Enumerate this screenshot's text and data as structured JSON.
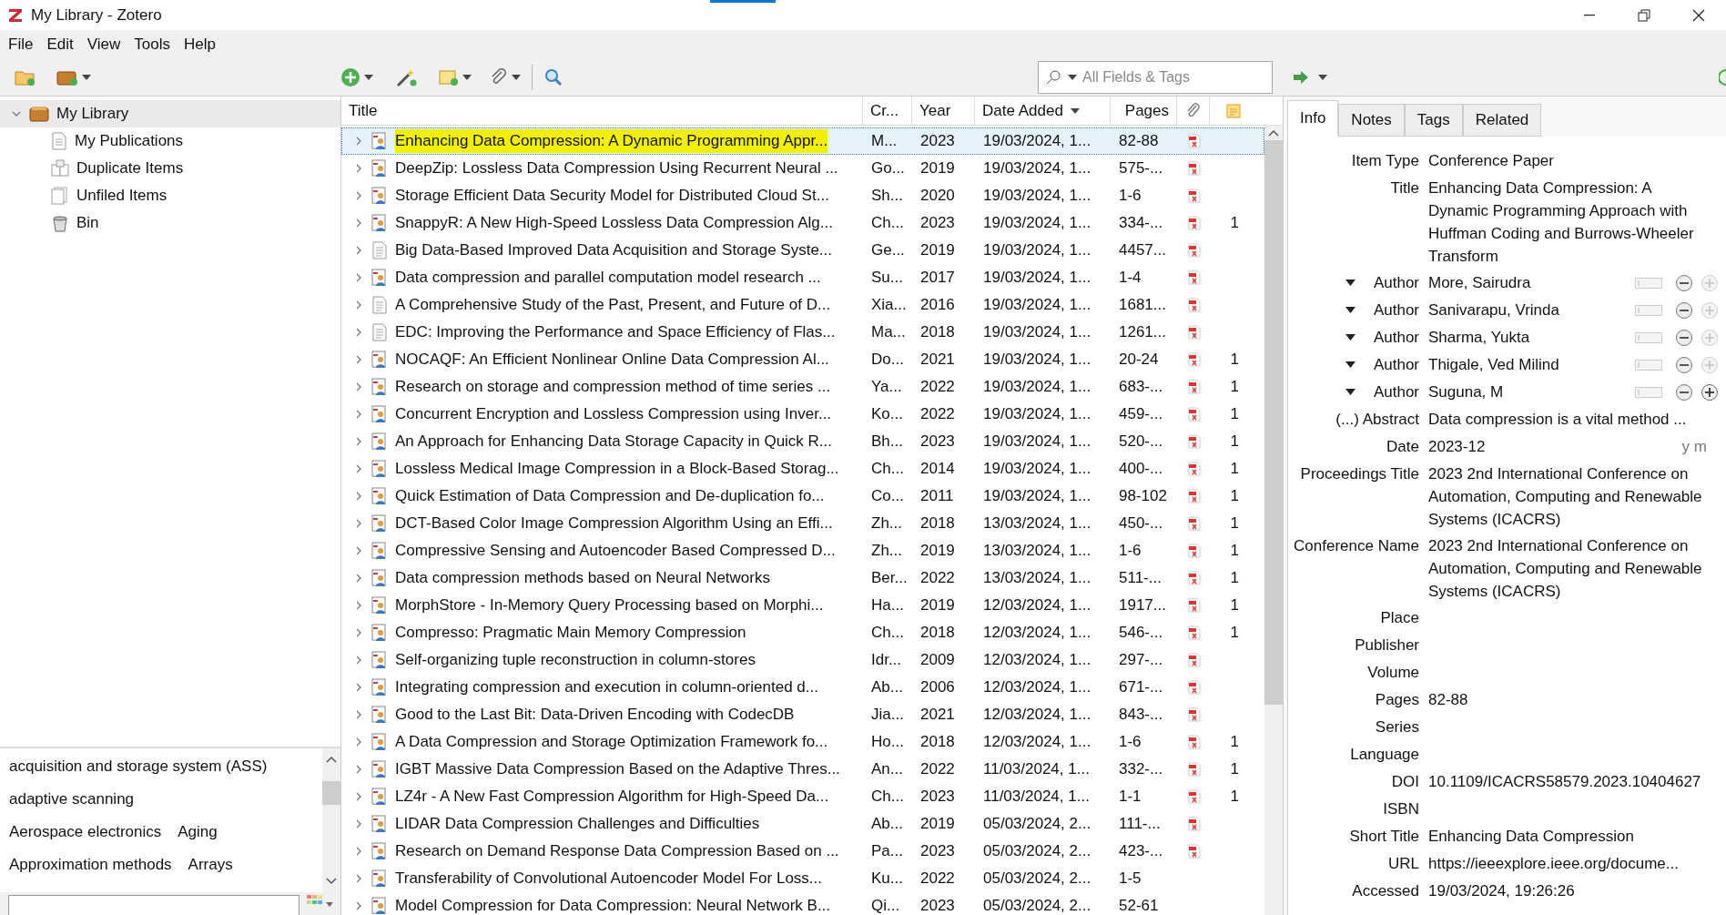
{
  "window": {
    "title": "My Library - Zotero"
  },
  "menu": [
    "File",
    "Edit",
    "View",
    "Tools",
    "Help"
  ],
  "search": {
    "placeholder": "All Fields & Tags"
  },
  "collections": [
    {
      "label": "My Library",
      "kind": "library",
      "expanded": true,
      "children": [
        {
          "label": "My Publications",
          "kind": "publications"
        },
        {
          "label": "Duplicate Items",
          "kind": "duplicates"
        },
        {
          "label": "Unfiled Items",
          "kind": "unfiled"
        },
        {
          "label": "Bin",
          "kind": "bin"
        }
      ]
    }
  ],
  "tags": [
    [
      "acquisition and storage system (ASS)"
    ],
    [
      "adaptive scanning"
    ],
    [
      "Aerospace electronics",
      "Aging"
    ],
    [
      "Approximation methods",
      "Arrays"
    ]
  ],
  "table": {
    "columns": [
      "Title",
      "Cr...",
      "Year",
      "Date Added",
      "Pages"
    ],
    "rows": [
      {
        "title": "Enhancing Data Compression: A Dynamic Programming Appr...",
        "creator": "M...",
        "year": "2023",
        "date": "19/03/2024, 1...",
        "pages": "82-88",
        "kind": "paper",
        "pdf": true,
        "notes": "",
        "selected": true,
        "highlighted": true
      },
      {
        "title": "DeepZip: Lossless Data Compression Using Recurrent Neural ...",
        "creator": "Go...",
        "year": "2019",
        "date": "19/03/2024, 1...",
        "pages": "575-...",
        "kind": "paper",
        "pdf": true,
        "notes": "",
        "selected": false,
        "highlighted": false
      },
      {
        "title": "Storage Efficient Data Security Model for Distributed Cloud St...",
        "creator": "Sh...",
        "year": "2020",
        "date": "19/03/2024, 1...",
        "pages": "1-6",
        "kind": "paper",
        "pdf": true,
        "notes": "",
        "selected": false,
        "highlighted": false
      },
      {
        "title": "SnappyR: A New High-Speed Lossless Data Compression Alg...",
        "creator": "Ch...",
        "year": "2023",
        "date": "19/03/2024, 1...",
        "pages": "334-...",
        "kind": "paper",
        "pdf": true,
        "notes": "1",
        "selected": false,
        "highlighted": false
      },
      {
        "title": "Big Data-Based Improved Data Acquisition and Storage Syste...",
        "creator": "Ge...",
        "year": "2019",
        "date": "19/03/2024, 1...",
        "pages": "4457...",
        "kind": "document",
        "pdf": true,
        "notes": "",
        "selected": false,
        "highlighted": false
      },
      {
        "title": "Data compression and parallel computation model research ...",
        "creator": "Su...",
        "year": "2017",
        "date": "19/03/2024, 1...",
        "pages": "1-4",
        "kind": "paper",
        "pdf": true,
        "notes": "",
        "selected": false,
        "highlighted": false
      },
      {
        "title": "A Comprehensive Study of the Past, Present, and Future of D...",
        "creator": "Xia...",
        "year": "2016",
        "date": "19/03/2024, 1...",
        "pages": "1681...",
        "kind": "document",
        "pdf": true,
        "notes": "",
        "selected": false,
        "highlighted": false
      },
      {
        "title": "EDC: Improving the Performance and Space Efficiency of Flas...",
        "creator": "Ma...",
        "year": "2018",
        "date": "19/03/2024, 1...",
        "pages": "1261...",
        "kind": "document",
        "pdf": true,
        "notes": "",
        "selected": false,
        "highlighted": false
      },
      {
        "title": "NOCAQF: An Efficient Nonlinear Online Data Compression Al...",
        "creator": "Do...",
        "year": "2021",
        "date": "19/03/2024, 1...",
        "pages": "20-24",
        "kind": "paper",
        "pdf": true,
        "notes": "1",
        "selected": false,
        "highlighted": false
      },
      {
        "title": "Research on storage and compression method of time series ...",
        "creator": "Ya...",
        "year": "2022",
        "date": "19/03/2024, 1...",
        "pages": "683-...",
        "kind": "paper",
        "pdf": true,
        "notes": "1",
        "selected": false,
        "highlighted": false
      },
      {
        "title": "Concurrent Encryption and Lossless Compression using Inver...",
        "creator": "Ko...",
        "year": "2022",
        "date": "19/03/2024, 1...",
        "pages": "459-...",
        "kind": "paper",
        "pdf": true,
        "notes": "1",
        "selected": false,
        "highlighted": false
      },
      {
        "title": "An Approach for Enhancing Data Storage Capacity in Quick R...",
        "creator": "Bh...",
        "year": "2023",
        "date": "19/03/2024, 1...",
        "pages": "520-...",
        "kind": "paper",
        "pdf": true,
        "notes": "1",
        "selected": false,
        "highlighted": false
      },
      {
        "title": "Lossless Medical Image Compression in a Block-Based Storag...",
        "creator": "Ch...",
        "year": "2014",
        "date": "19/03/2024, 1...",
        "pages": "400-...",
        "kind": "paper",
        "pdf": true,
        "notes": "1",
        "selected": false,
        "highlighted": false
      },
      {
        "title": "Quick Estimation of Data Compression and De-duplication fo...",
        "creator": "Co...",
        "year": "2011",
        "date": "19/03/2024, 1...",
        "pages": "98-102",
        "kind": "paper",
        "pdf": true,
        "notes": "1",
        "selected": false,
        "highlighted": false
      },
      {
        "title": "DCT-Based Color Image Compression Algorithm Using an Effi...",
        "creator": "Zh...",
        "year": "2018",
        "date": "13/03/2024, 1...",
        "pages": "450-...",
        "kind": "paper",
        "pdf": true,
        "notes": "1",
        "selected": false,
        "highlighted": false
      },
      {
        "title": "Compressive Sensing and Autoencoder Based Compressed D...",
        "creator": "Zh...",
        "year": "2019",
        "date": "13/03/2024, 1...",
        "pages": "1-6",
        "kind": "paper",
        "pdf": true,
        "notes": "1",
        "selected": false,
        "highlighted": false
      },
      {
        "title": "Data compression methods based on Neural Networks",
        "creator": "Ber...",
        "year": "2022",
        "date": "13/03/2024, 1...",
        "pages": "511-...",
        "kind": "paper",
        "pdf": true,
        "notes": "1",
        "selected": false,
        "highlighted": false
      },
      {
        "title": "MorphStore - In-Memory Query Processing based on Morphi...",
        "creator": "Ha...",
        "year": "2019",
        "date": "12/03/2024, 1...",
        "pages": "1917...",
        "kind": "paper",
        "pdf": true,
        "notes": "1",
        "selected": false,
        "highlighted": false
      },
      {
        "title": "Compresso: Pragmatic Main Memory Compression",
        "creator": "Ch...",
        "year": "2018",
        "date": "12/03/2024, 1...",
        "pages": "546-...",
        "kind": "paper",
        "pdf": true,
        "notes": "1",
        "selected": false,
        "highlighted": false
      },
      {
        "title": "Self-organizing tuple reconstruction in column-stores",
        "creator": "Idr...",
        "year": "2009",
        "date": "12/03/2024, 1...",
        "pages": "297-...",
        "kind": "paper",
        "pdf": true,
        "notes": "",
        "selected": false,
        "highlighted": false
      },
      {
        "title": "Integrating compression and execution in column-oriented d...",
        "creator": "Ab...",
        "year": "2006",
        "date": "12/03/2024, 1...",
        "pages": "671-...",
        "kind": "paper",
        "pdf": true,
        "notes": "",
        "selected": false,
        "highlighted": false
      },
      {
        "title": "Good to the Last Bit: Data-Driven Encoding with CodecDB",
        "creator": "Jia...",
        "year": "2021",
        "date": "12/03/2024, 1...",
        "pages": "843-...",
        "kind": "paper",
        "pdf": true,
        "notes": "",
        "selected": false,
        "highlighted": false
      },
      {
        "title": "A Data Compression and Storage Optimization Framework fo...",
        "creator": "Ho...",
        "year": "2018",
        "date": "12/03/2024, 1...",
        "pages": "1-6",
        "kind": "paper",
        "pdf": true,
        "notes": "1",
        "selected": false,
        "highlighted": false
      },
      {
        "title": "IGBT Massive Data Compression Based on the Adaptive Thres...",
        "creator": "An...",
        "year": "2022",
        "date": "11/03/2024, 1...",
        "pages": "332-...",
        "kind": "paper",
        "pdf": true,
        "notes": "1",
        "selected": false,
        "highlighted": false
      },
      {
        "title": "LZ4r - A New Fast Compression Algorithm for High-Speed Da...",
        "creator": "Ch...",
        "year": "2023",
        "date": "11/03/2024, 1...",
        "pages": "1-1",
        "kind": "paper",
        "pdf": true,
        "notes": "1",
        "selected": false,
        "highlighted": false
      },
      {
        "title": "LIDAR Data Compression Challenges and Difficulties",
        "creator": "Ab...",
        "year": "2019",
        "date": "05/03/2024, 2...",
        "pages": "111-...",
        "kind": "paper",
        "pdf": true,
        "notes": "",
        "selected": false,
        "highlighted": false
      },
      {
        "title": "Research on Demand Response Data Compression Based on ...",
        "creator": "Pa...",
        "year": "2023",
        "date": "05/03/2024, 2...",
        "pages": "423-...",
        "kind": "paper",
        "pdf": true,
        "notes": "",
        "selected": false,
        "highlighted": false
      },
      {
        "title": "Transferability of Convolutional Autoencoder Model For Loss...",
        "creator": "Ku...",
        "year": "2022",
        "date": "05/03/2024, 2...",
        "pages": "1-5",
        "kind": "paper",
        "pdf": false,
        "notes": "",
        "selected": false,
        "highlighted": false
      },
      {
        "title": "Model Compression for Data Compression: Neural Network B...",
        "creator": "Qi...",
        "year": "2023",
        "date": "05/03/2024, 2...",
        "pages": "52-61",
        "kind": "paper",
        "pdf": false,
        "notes": "",
        "selected": false,
        "highlighted": false
      }
    ]
  },
  "pane": {
    "tabs": [
      {
        "label": "Info",
        "selected": true
      },
      {
        "label": "Notes",
        "selected": false
      },
      {
        "label": "Tags",
        "selected": false
      },
      {
        "label": "Related",
        "selected": false
      }
    ],
    "fields": [
      {
        "kind": "field",
        "label": "Item Type",
        "value": "Conference Paper"
      },
      {
        "kind": "field",
        "label": "Title",
        "value": "Enhancing Data Compression: A Dynamic Programming Approach with Huffman Coding and Burrows-Wheeler Transform"
      },
      {
        "kind": "author",
        "label": "Author",
        "value": "More, Sairudra",
        "add_enabled": false
      },
      {
        "kind": "author",
        "label": "Author",
        "value": "Sanivarapu, Vrinda",
        "add_enabled": false
      },
      {
        "kind": "author",
        "label": "Author",
        "value": "Sharma, Yukta",
        "add_enabled": false
      },
      {
        "kind": "author",
        "label": "Author",
        "value": "Thigale, Ved Milind",
        "add_enabled": false
      },
      {
        "kind": "author",
        "label": "Author",
        "value": "Suguna, M",
        "add_enabled": true
      },
      {
        "kind": "field",
        "label": "(...) Abstract",
        "value": "Data compression is a vital method ..."
      },
      {
        "kind": "field",
        "label": "Date",
        "value": "2023-12",
        "hint": "y m"
      },
      {
        "kind": "field",
        "label": "Proceedings Title",
        "value": "2023 2nd International Conference on Automation, Computing and Renewable Systems (ICACRS)"
      },
      {
        "kind": "field",
        "label": "Conference Name",
        "value": "2023 2nd International Conference on Automation, Computing and Renewable Systems (ICACRS)"
      },
      {
        "kind": "field",
        "label": "Place"
      },
      {
        "kind": "field",
        "label": "Publisher"
      },
      {
        "kind": "field",
        "label": "Volume"
      },
      {
        "kind": "field",
        "label": "Pages",
        "value": "82-88"
      },
      {
        "kind": "field",
        "label": "Series"
      },
      {
        "kind": "field",
        "label": "Language"
      },
      {
        "kind": "field",
        "label": "DOI",
        "value": "10.1109/ICACRS58579.2023.10404627"
      },
      {
        "kind": "field",
        "label": "ISBN"
      },
      {
        "kind": "field",
        "label": "Short Title",
        "value": "Enhancing Data Compression"
      },
      {
        "kind": "field",
        "label": "URL",
        "value": "https://ieeexplore.ieee.org/docume..."
      },
      {
        "kind": "field",
        "label": "Accessed",
        "value": "19/03/2024, 19:26:26"
      }
    ]
  }
}
